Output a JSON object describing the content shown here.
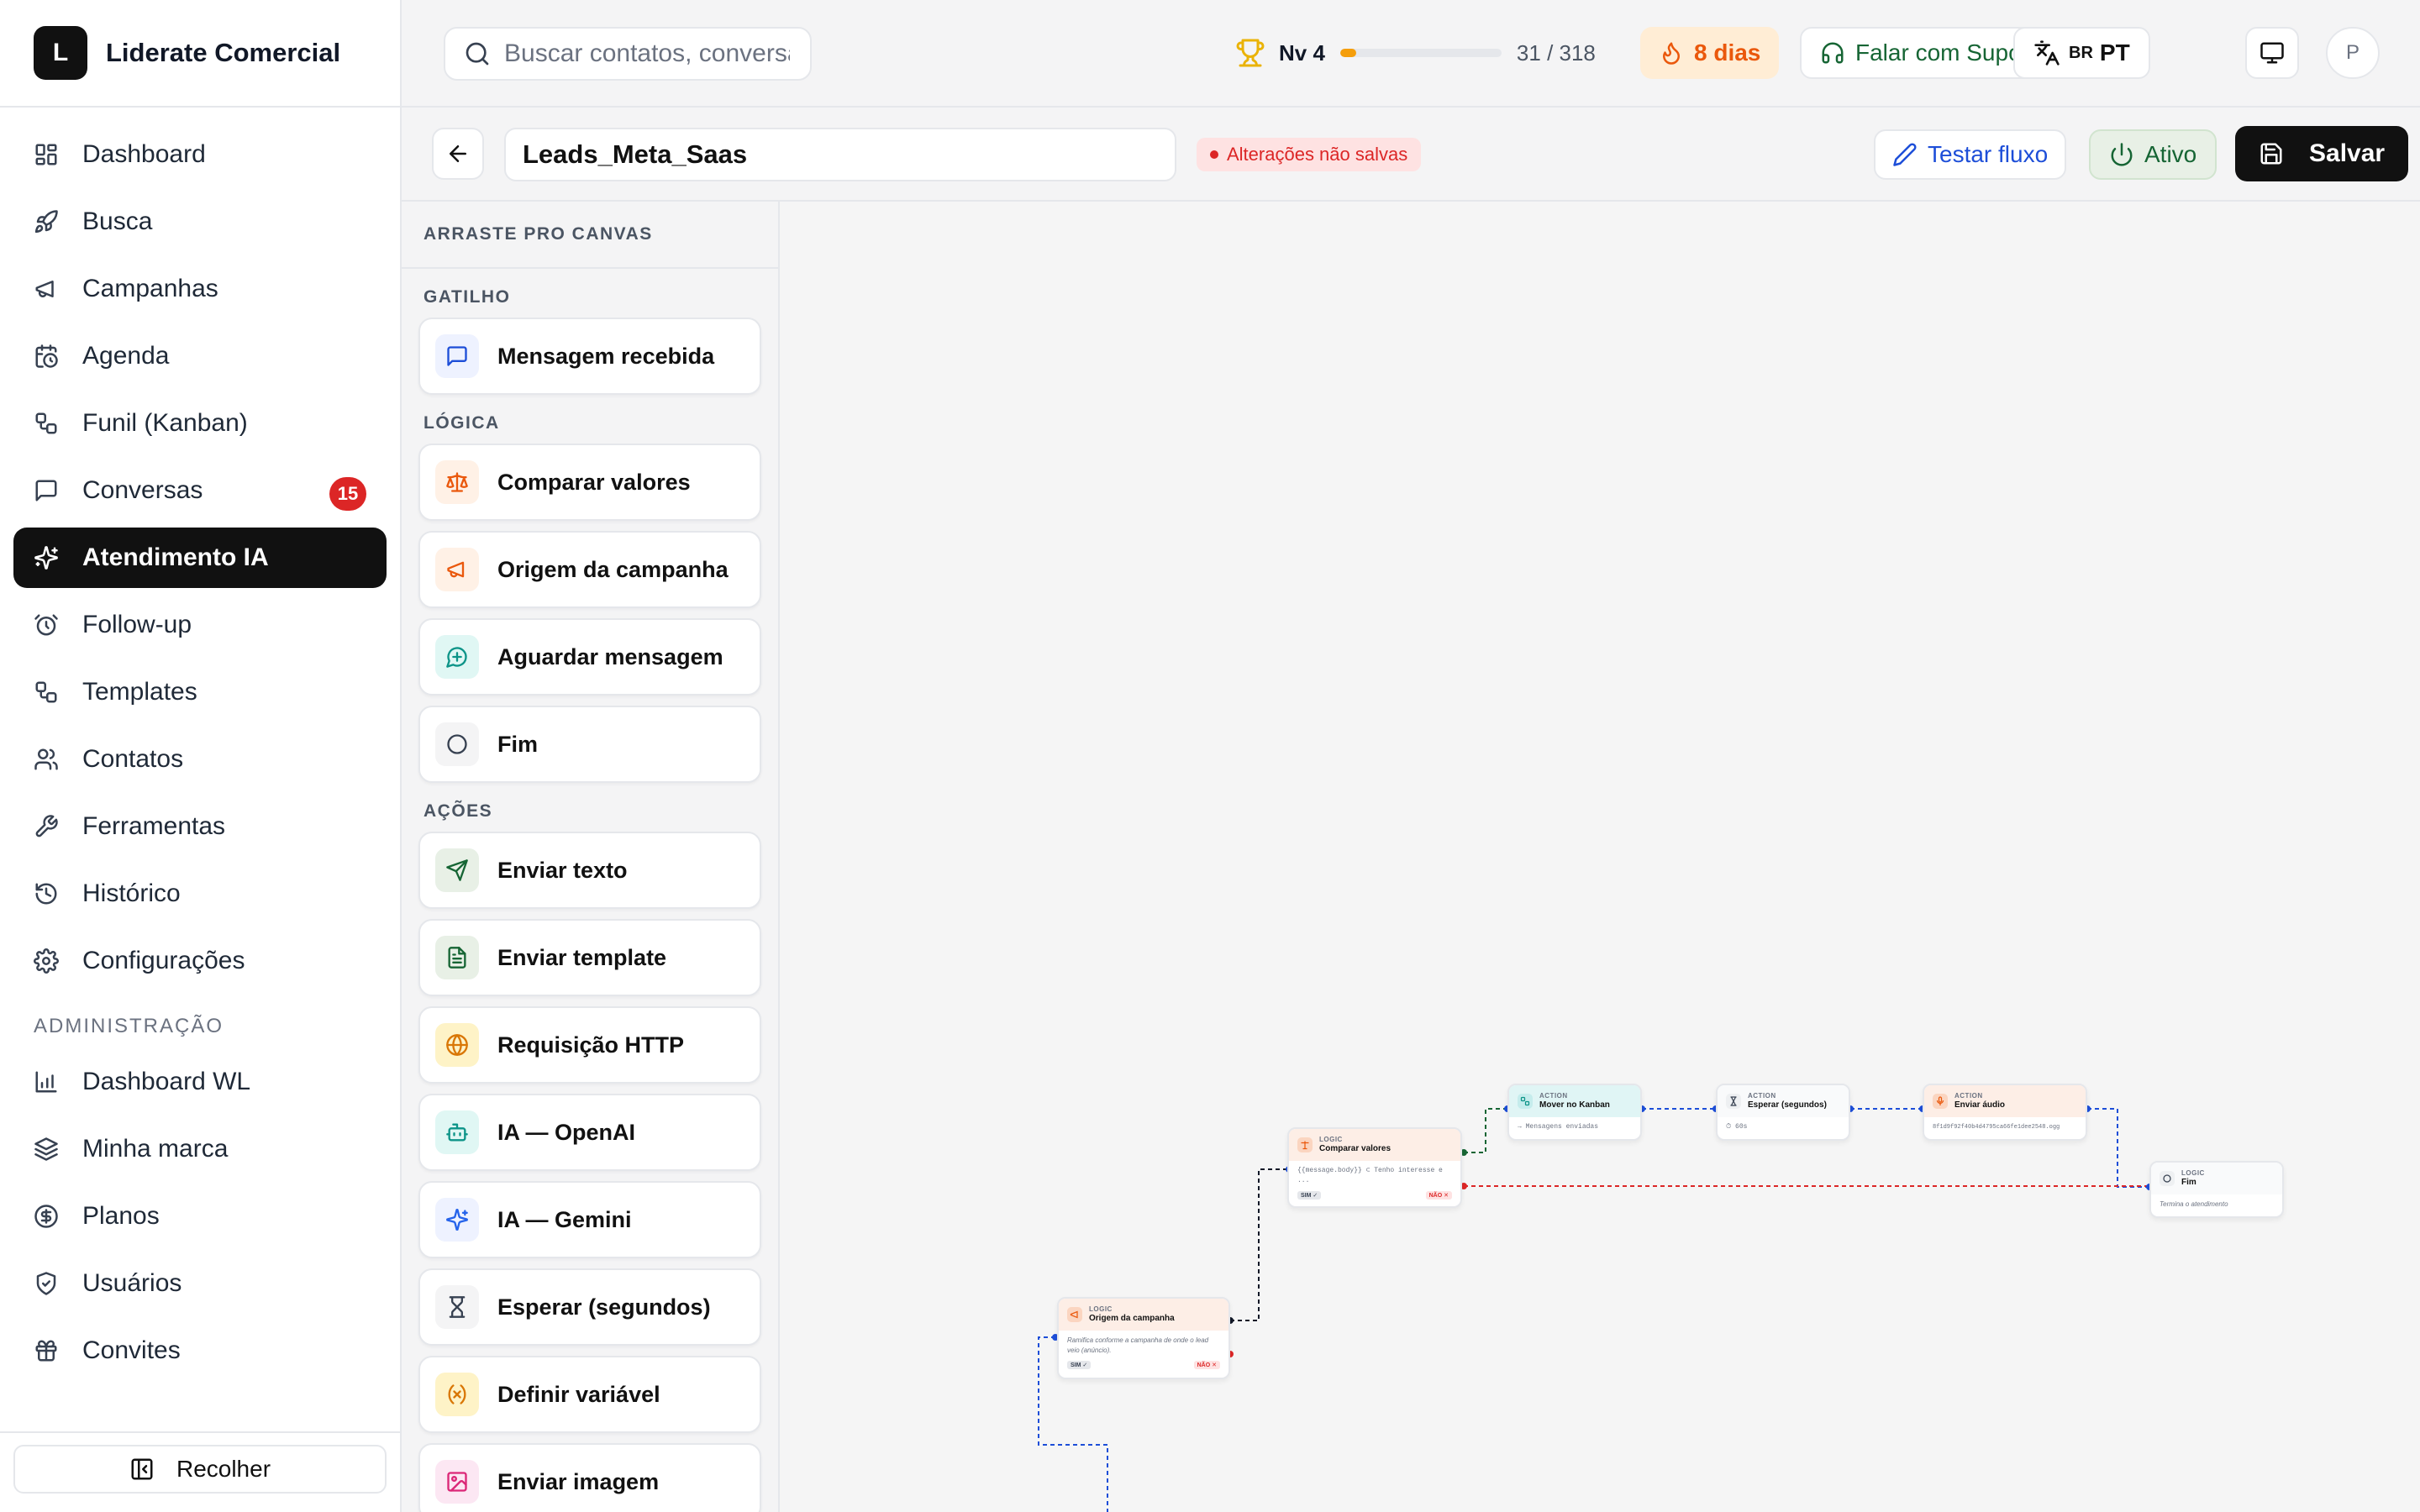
{
  "brand": {
    "logo_letter": "L",
    "name": "Liderate Comercial"
  },
  "nav": {
    "items": [
      {
        "label": "Dashboard",
        "icon": "dashboard-icon"
      },
      {
        "label": "Busca",
        "icon": "rocket-icon"
      },
      {
        "label": "Campanhas",
        "icon": "megaphone-icon"
      },
      {
        "label": "Agenda",
        "icon": "calendar-clock-icon"
      },
      {
        "label": "Funil (Kanban)",
        "icon": "workflow-icon"
      },
      {
        "label": "Conversas",
        "icon": "chat-icon",
        "badge": "15"
      },
      {
        "label": "Atendimento IA",
        "icon": "sparkles-icon",
        "active": true
      },
      {
        "label": "Follow-up",
        "icon": "alarm-clock-icon"
      },
      {
        "label": "Templates",
        "icon": "workflow-icon"
      },
      {
        "label": "Contatos",
        "icon": "users-icon"
      },
      {
        "label": "Ferramentas",
        "icon": "wrench-icon"
      },
      {
        "label": "Histórico",
        "icon": "history-icon"
      },
      {
        "label": "Configurações",
        "icon": "gear-icon"
      }
    ],
    "admin_section": "ADMINISTRAÇÃO",
    "admin_items": [
      {
        "label": "Dashboard WL",
        "icon": "bar-chart-icon"
      },
      {
        "label": "Minha marca",
        "icon": "layers-icon"
      },
      {
        "label": "Planos",
        "icon": "dollar-circle-icon"
      },
      {
        "label": "Usuários",
        "icon": "shield-icon"
      },
      {
        "label": "Convites",
        "icon": "gift-icon"
      }
    ],
    "collapse_label": "Recolher"
  },
  "topbar": {
    "search_placeholder": "Buscar contatos, conversas...",
    "level_label": "Nv 4",
    "level_progress": 0.0975,
    "level_count": "31 / 318",
    "streak": "8 dias",
    "support": "Falar com Suporte",
    "lang_flag": "BR",
    "lang_code": "PT",
    "avatar_initial": "P"
  },
  "flowbar": {
    "flow_name": "Leads_Meta_Saas",
    "unsaved": "Alterações não salvas",
    "test": "Testar fluxo",
    "active": "Ativo",
    "save": "Salvar"
  },
  "palette": {
    "title": "ARRASTE PRO CANVAS",
    "groups": [
      {
        "title": "GATILHO",
        "items": [
          {
            "label": "Mensagem recebida",
            "icon": "message-square-icon",
            "color": "#1d4ed8",
            "bg": "#eef2ff"
          }
        ]
      },
      {
        "title": "LÓGICA",
        "items": [
          {
            "label": "Comparar valores",
            "icon": "scale-icon",
            "color": "#ea580c",
            "bg": "#fff1e6"
          },
          {
            "label": "Origem da campanha",
            "icon": "megaphone-icon",
            "color": "#ea580c",
            "bg": "#fff1e6"
          },
          {
            "label": "Aguardar mensagem",
            "icon": "message-plus-icon",
            "color": "#0d9488",
            "bg": "#e0f7f4"
          },
          {
            "label": "Fim",
            "icon": "circle-icon",
            "color": "#374151",
            "bg": "#f4f4f5"
          }
        ]
      },
      {
        "title": "AÇÕES",
        "items": [
          {
            "label": "Enviar texto",
            "icon": "send-icon",
            "color": "#166534",
            "bg": "#e8f0e6"
          },
          {
            "label": "Enviar template",
            "icon": "file-text-icon",
            "color": "#166534",
            "bg": "#e8f0e6"
          },
          {
            "label": "Requisição HTTP",
            "icon": "globe-icon",
            "color": "#d97706",
            "bg": "#fef3c7"
          },
          {
            "label": "IA — OpenAI",
            "icon": "bot-icon",
            "color": "#0d9488",
            "bg": "#e0f7f4"
          },
          {
            "label": "IA — Gemini",
            "icon": "sparkles-icon",
            "color": "#2563eb",
            "bg": "#eef2ff"
          },
          {
            "label": "Esperar (segundos)",
            "icon": "hourglass-icon",
            "color": "#374151",
            "bg": "#f4f4f5"
          },
          {
            "label": "Definir variável",
            "icon": "variable-icon",
            "color": "#d97706",
            "bg": "#fef3c7"
          },
          {
            "label": "Enviar imagem",
            "icon": "image-icon",
            "color": "#db2777",
            "bg": "#fce7f3"
          }
        ]
      }
    ]
  },
  "canvas": {
    "nodes": {
      "origem": {
        "kind": "LOGIC",
        "title": "Origem da campanha",
        "body": "Ramifica conforme a campanha de onde o lead veio (anúncio).",
        "yes": "SIM ✓",
        "no": "NÃO ✕"
      },
      "comparar": {
        "kind": "LOGIC",
        "title": "Comparar valores",
        "body": "{{message.body}} ⊂ Tenho interesse e ...",
        "yes": "SIM ✓",
        "no": "NÃO ✕"
      },
      "mover": {
        "kind": "ACTION",
        "title": "Mover no Kanban",
        "body": "→ Mensagens enviadas"
      },
      "esperar": {
        "kind": "ACTION",
        "title": "Esperar (segundos)",
        "body": "⏱ 60s"
      },
      "audio": {
        "kind": "ACTION",
        "title": "Enviar áudio",
        "body": "8f1d9f92f40b4d4795ca66fe1dee2548.ogg"
      },
      "fim": {
        "kind": "LOGIC",
        "title": "Fim",
        "body": "Termina o atendimento"
      }
    }
  },
  "colors": {
    "accent": "#111111",
    "danger": "#dc2626",
    "success": "#166534",
    "link": "#1d4ed8",
    "wire_blue": "#1d4ed8",
    "wire_red": "#dc2626",
    "wire_green": "#166534"
  }
}
